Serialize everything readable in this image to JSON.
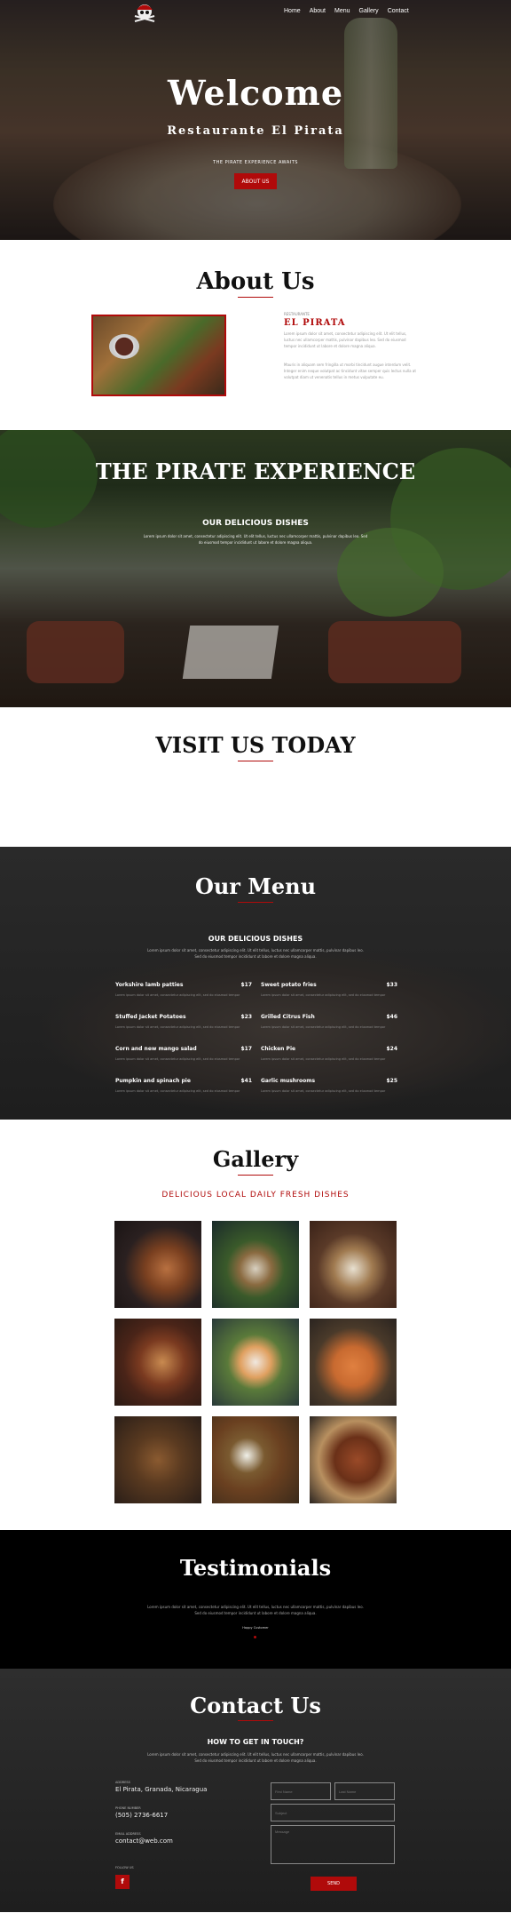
{
  "nav": {
    "logo_icon": "pirate-skull-icon",
    "links": [
      "Home",
      "About",
      "Menu",
      "Gallery",
      "Contact"
    ]
  },
  "hero": {
    "title": "Welcome",
    "subtitle": "Restaurante El Pirata",
    "tagline": "THE PIRATE EXPERIENCE AWAITS",
    "button": "ABOUT US"
  },
  "about": {
    "title": "About Us",
    "kicker": "RESTAURANTE",
    "name": "EL PIRATA",
    "paragraph1": "Lorem ipsum dolor sit amet, consectetur adipiscing elit. Ut elit tellus, luctus nec ullamcorper mattis, pulvinar dapibus leo. Sed do eiusmod tempor incididunt ut labore et dolore magna aliqua.",
    "paragraph2": "Mauris in aliquam sem fringilla ut morbi tincidunt augue interdum velit. Integer enim neque volutpat ac tincidunt vitae semper quis lectus nulla at volutpat diam ut venenatis tellus in metus vulputate eu."
  },
  "pirate": {
    "title": "THE PIRATE EXPERIENCE",
    "subtitle": "OUR DELICIOUS DISHES",
    "description": "Lorem ipsum dolor sit amet, consectetur adipiscing elit. Ut elit tellus, luctus nec ullamcorper mattis, pulvinar dapibus leo. Sed do eiusmod tempor incididunt ut labore et dolore magna aliqua."
  },
  "visit": {
    "title": "VISIT US TODAY"
  },
  "menu": {
    "title": "Our Menu",
    "subtitle": "OUR DELICIOUS DISHES",
    "description": "Lorem ipsum dolor sit amet, consectetur adipiscing elit. Ut elit tellus, luctus nec ullamcorper mattis, pulvinar dapibus leo. Sed do eiusmod tempor incididunt ut labore et dolore magna aliqua.",
    "items": [
      {
        "name": "Yorkshire lamb patties",
        "price": "$17",
        "desc": "Lorem ipsum dolor sit amet, consectetur adipiscing elit, sed do eiusmod tempor"
      },
      {
        "name": "Sweet potato fries",
        "price": "$33",
        "desc": "Lorem ipsum dolor sit amet, consectetur adipiscing elit, sed do eiusmod tempor"
      },
      {
        "name": "Stuffed Jacket Potatoes",
        "price": "$23",
        "desc": "Lorem ipsum dolor sit amet, consectetur adipiscing elit, sed do eiusmod tempor"
      },
      {
        "name": "Grilled Citrus Fish",
        "price": "$46",
        "desc": "Lorem ipsum dolor sit amet, consectetur adipiscing elit, sed do eiusmod tempor"
      },
      {
        "name": "Corn and new mango salad",
        "price": "$17",
        "desc": "Lorem ipsum dolor sit amet, consectetur adipiscing elit, sed do eiusmod tempor"
      },
      {
        "name": "Chicken Pie",
        "price": "$24",
        "desc": "Lorem ipsum dolor sit amet, consectetur adipiscing elit, sed do eiusmod tempor"
      },
      {
        "name": "Pumpkin and spinach pie",
        "price": "$41",
        "desc": "Lorem ipsum dolor sit amet, consectetur adipiscing elit, sed do eiusmod tempor"
      },
      {
        "name": "Garlic mushrooms",
        "price": "$25",
        "desc": "Lorem ipsum dolor sit amet, consectetur adipiscing elit, sed do eiusmod tempor"
      }
    ]
  },
  "gallery": {
    "title": "Gallery",
    "subtitle": "DELICIOUS LOCAL DAILY FRESH DISHES"
  },
  "testimonials": {
    "title": "Testimonials",
    "quote": "Lorem ipsum dolor sit amet, consectetur adipiscing elit. Ut elit tellus, luctus nec ullamcorper mattis, pulvinar dapibus leo. Sed do eiusmod tempor incididunt ut labore et dolore magna aliqua.",
    "author": "Happy Customer"
  },
  "contact": {
    "title": "Contact Us",
    "subtitle": "HOW TO GET IN TOUCH?",
    "description": "Lorem ipsum dolor sit amet, consectetur adipiscing elit. Ut elit tellus, luctus nec ullamcorper mattis, pulvinar dapibus leo. Sed do eiusmod tempor incididunt ut labore et dolore magna aliqua.",
    "address_label": "ADDRESS",
    "address": "El Pirata, Granada, Nicaragua",
    "phone_label": "PHONE NUMBER",
    "phone": "(505) 2736-6617",
    "email_label": "EMAIL ADDRESS",
    "email": "contact@web.com",
    "social_label": "FOLLOW US",
    "social_icon": "facebook-icon",
    "form": {
      "first_name": "First Name",
      "last_name": "Last Name",
      "subject": "Subject",
      "message": "Message",
      "submit": "SEND"
    }
  },
  "colors": {
    "accent": "#b00a0a",
    "dark": "#1e1e1e"
  }
}
